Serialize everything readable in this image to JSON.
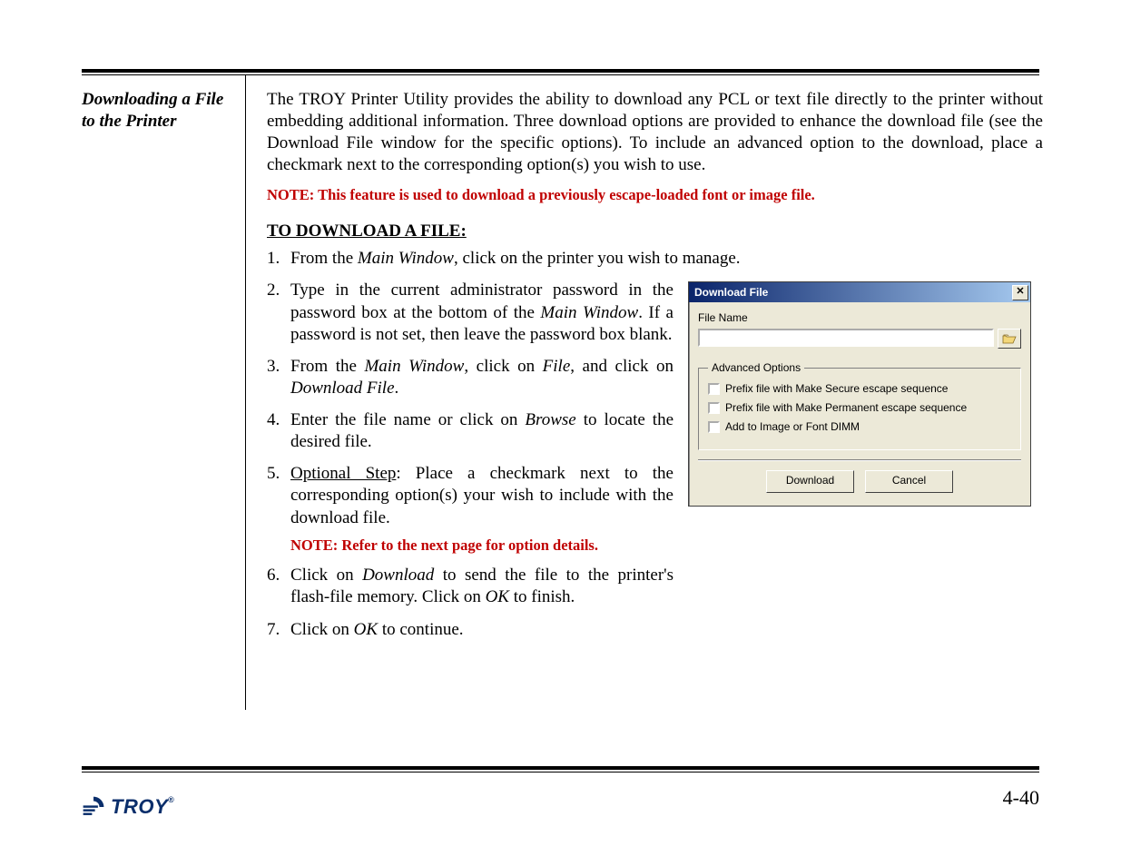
{
  "sidebar": {
    "title": "Downloading a File to the Printer"
  },
  "intro": {
    "para": "The TROY Printer Utility provides the ability to download any PCL or text file directly to the printer without embedding additional information.  Three download options are provided to enhance the download file (see the Download File window for the specific options).  To include an advanced option to the download, place a checkmark next to the corresponding option(s) you wish to use.",
    "note": "NOTE: This feature is used to download a previously escape-loaded font or image file."
  },
  "heading": "TO DOWNLOAD A FILE:",
  "steps": {
    "s1_a": "From the ",
    "s1_b": "Main Window",
    "s1_c": ", click on the printer you wish to manage.",
    "s2_a": "Type in the current administrator password in the password box at the bottom of the ",
    "s2_b": "Main Window",
    "s2_c": ".  If a password is not set, then leave the password box blank.",
    "s3_a": "From the ",
    "s3_b": "Main Window",
    "s3_c": ", click on ",
    "s3_d": "File",
    "s3_e": ", and click on ",
    "s3_f": "Download File",
    "s3_g": ".",
    "s4_a": "Enter the file name or click on ",
    "s4_b": "Browse",
    "s4_c": " to locate the desired file.",
    "s5_label": "Optional Step",
    "s5_a": ":  Place a checkmark next to the corresponding option(s) your wish to include with the download file.",
    "s5_note": "NOTE: Refer to the next page for option details.",
    "s6_a": "Click on ",
    "s6_b": "Download",
    "s6_c": " to send the file to the printer's flash-file memory.  Click on ",
    "s6_d": "OK",
    "s6_e": " to finish.",
    "s7_a": "Click on ",
    "s7_b": "OK",
    "s7_c": " to continue."
  },
  "dialog": {
    "title": "Download File",
    "file_label": "File Name",
    "group": "Advanced Options",
    "opt1": "Prefix file with Make Secure escape sequence",
    "opt2": "Prefix file with Make Permanent escape sequence",
    "opt3": "Add to Image or Font DIMM",
    "btn_download": "Download",
    "btn_cancel": "Cancel"
  },
  "pagenum": "4-40",
  "logo_text": "TROY"
}
